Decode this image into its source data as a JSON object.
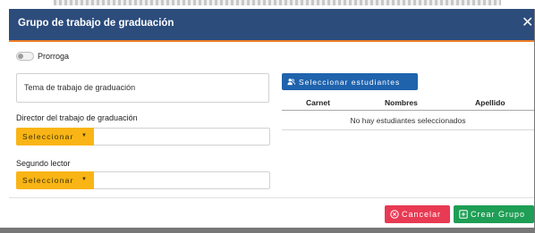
{
  "modal": {
    "title": "Grupo de trabajo de graduación",
    "close_glyph": "✕"
  },
  "form": {
    "toggle_label": "Prorroga",
    "toggle_on": false,
    "tema_label": "Tema de trabajo de graduación",
    "director_label": "Director del trabajo de graduación",
    "director_button": "Seleccionar",
    "director_value": "",
    "lector_label": "Segundo lector",
    "lector_button": "Seleccionar",
    "lector_value": ""
  },
  "students": {
    "button_label": "Seleccionar estudiantes",
    "columns": [
      "Carnet",
      "Nombres",
      "Apellido"
    ],
    "empty_message": "No hay estudiantes seleccionados"
  },
  "footer": {
    "cancel_label": "Cancelar",
    "create_label": "Crear Grupo"
  },
  "colors": {
    "header": "#2c4c7c",
    "header_accent": "#ef7f2a",
    "select_button": "#f9b515",
    "primary": "#1f63ad",
    "danger": "#e83a53",
    "success": "#1f9e55"
  },
  "icons": {
    "close": "close-icon",
    "caret": "caret-down-icon",
    "students": "users-icon",
    "cancel": "cancel-circle-icon",
    "create": "add-square-icon"
  }
}
